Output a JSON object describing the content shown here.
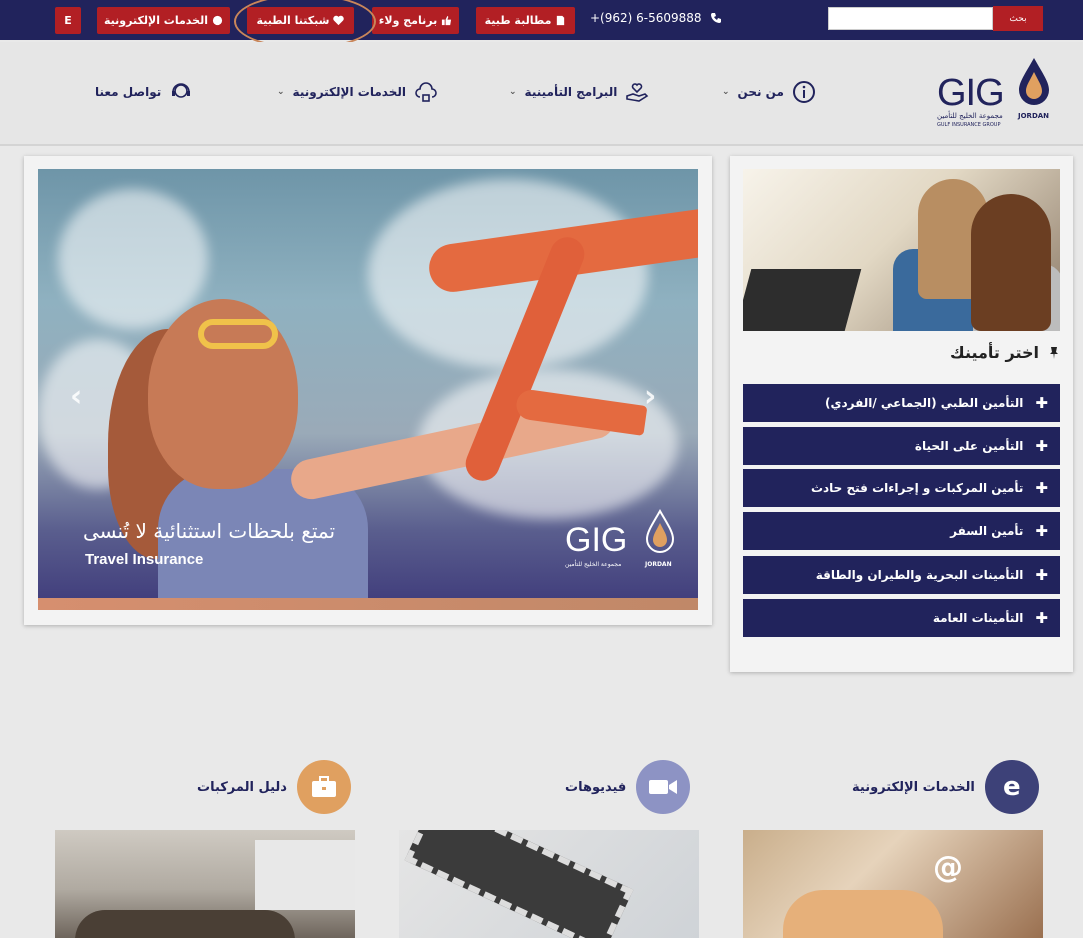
{
  "topbar": {
    "lang_button": "E",
    "eservices_button": "الخدمات الإلكترونية",
    "network_button": "شبكتنا الطبية",
    "loyalty_button": "برنامج ولاء",
    "claim_button": "مطالبة طبية",
    "phone": "+(962) 6-5609888",
    "search_placeholder": "",
    "search_button": "بحث"
  },
  "logo": {
    "brand": "GIG",
    "arabic_name": "مجموعة الخليج للتأمين",
    "english_name": "GULF INSURANCE GROUP",
    "country": "JORDAN"
  },
  "nav": {
    "about": "من نحن",
    "programs": "البرامج التأمينية",
    "eservices": "الخدمات الإلكترونية",
    "contact": "تواصل معنا"
  },
  "choose": {
    "title": "اختر تأمينك",
    "items": [
      "التأمين الطبي (الجماعي /الفردي)",
      "التأمين على الحياة",
      "تأمين المركبات و إجراءات فتح حادث",
      "تأمين السفر",
      "التأمينات البحرية والطيران والطاقة",
      "التأمينات العامة"
    ]
  },
  "slider": {
    "arabic_caption": "تمتع بلحظات استثنائية لا تُنسى",
    "english_caption": "Travel Insurance",
    "logo_brand": "GIG",
    "logo_arabic": "مجموعة الخليج للتأمين",
    "logo_english": "GULF INSURANCE GROUP",
    "logo_country": "JORDAN",
    "prev": "‹",
    "next": "›"
  },
  "sections": {
    "vehicles": "دليل المركبات",
    "videos": "فيديوهات",
    "eservices": "الخدمات الإلكترونية"
  },
  "colors": {
    "navy": "#21235c",
    "red": "#b21f24",
    "orange": "#e0a060",
    "lavender": "#8d93c4"
  }
}
